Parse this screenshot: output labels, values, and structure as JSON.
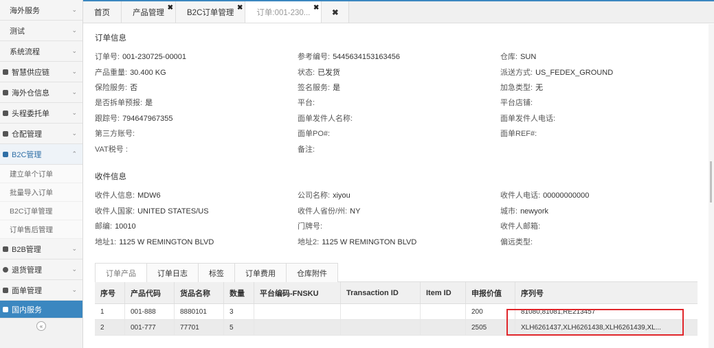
{
  "sidebar": {
    "items": [
      {
        "label": "海外服务"
      },
      {
        "label": "测试"
      },
      {
        "label": "系统流程"
      },
      {
        "label": "智慧供应链"
      },
      {
        "label": "海外仓信息"
      },
      {
        "label": "头程委托单"
      },
      {
        "label": "仓配管理"
      },
      {
        "label": "B2C管理"
      }
    ],
    "b2c_sub": [
      {
        "label": "建立单个订单"
      },
      {
        "label": "批量导入订单"
      },
      {
        "label": "B2C订单管理"
      },
      {
        "label": "订单售后管理"
      }
    ],
    "after": [
      {
        "label": "B2B管理"
      },
      {
        "label": "退货管理"
      },
      {
        "label": "面单管理"
      },
      {
        "label": "国内服务"
      }
    ],
    "collapse_glyph": "«"
  },
  "tabs": [
    {
      "label": "首页"
    },
    {
      "label": "产品管理",
      "close": "✖"
    },
    {
      "label": "B2C订单管理",
      "close": "✖"
    },
    {
      "label": "订单:001-230...",
      "close": "✖"
    },
    {
      "label": "✖"
    }
  ],
  "order_info": {
    "title": "订单信息",
    "fields": [
      {
        "label": "订单号:",
        "value": "001-230725-00001"
      },
      {
        "label": "参考编号:",
        "value": "5445634153163456"
      },
      {
        "label": "仓库:",
        "value": "SUN"
      },
      {
        "label": "产品重量:",
        "value": "30.400 KG"
      },
      {
        "label": "状态:",
        "value": "已发货"
      },
      {
        "label": "派送方式:",
        "value": "US_FEDEX_GROUND"
      },
      {
        "label": "保险服务:",
        "value": "否"
      },
      {
        "label": "签名服务:",
        "value": "是"
      },
      {
        "label": "加急类型:",
        "value": "无"
      },
      {
        "label": "是否拆单预报:",
        "value": "是"
      },
      {
        "label": "平台:",
        "value": ""
      },
      {
        "label": "平台店铺:",
        "value": ""
      },
      {
        "label": "跟踪号:",
        "value": "794647967355"
      },
      {
        "label": "面单发件人名称:",
        "value": ""
      },
      {
        "label": "面单发件人电话:",
        "value": ""
      },
      {
        "label": "第三方账号:",
        "value": ""
      },
      {
        "label": "面单PO#:",
        "value": ""
      },
      {
        "label": "面单REF#:",
        "value": ""
      },
      {
        "label": "VAT税号 :",
        "value": ""
      },
      {
        "label": "备注:",
        "value": ""
      }
    ]
  },
  "receiver_info": {
    "title": "收件信息",
    "fields": [
      {
        "label": "收件人信息:",
        "value": "MDW6"
      },
      {
        "label": "公司名称:",
        "value": "xiyou"
      },
      {
        "label": "收件人电话:",
        "value": "00000000000"
      },
      {
        "label": "收件人国家:",
        "value": "UNITED STATES/US"
      },
      {
        "label": "收件人省份/州:",
        "value": "NY"
      },
      {
        "label": "城市:",
        "value": "newyork"
      },
      {
        "label": "邮编:",
        "value": "10010"
      },
      {
        "label": "门牌号:",
        "value": ""
      },
      {
        "label": "收件人邮箱:",
        "value": ""
      },
      {
        "label": "地址1:",
        "value": "1125 W REMINGTON BLVD"
      },
      {
        "label": "地址2:",
        "value": "1125 W REMINGTON BLVD"
      },
      {
        "label": "偏远类型:",
        "value": ""
      }
    ]
  },
  "bottom_tabs": [
    {
      "label": "订单产品"
    },
    {
      "label": "订单日志"
    },
    {
      "label": "标签"
    },
    {
      "label": "订单费用"
    },
    {
      "label": "仓库附件"
    }
  ],
  "table": {
    "headers": [
      "序号",
      "产品代码",
      "货品名称",
      "数量",
      "平台编码-FNSKU",
      "Transaction ID",
      "Item ID",
      "申报价值",
      "序列号"
    ],
    "rows": [
      [
        "1",
        "001-888",
        "8880101",
        "3",
        "",
        "",
        "",
        "200",
        "81080,81081,RE213457"
      ],
      [
        "2",
        "001-777",
        "77701",
        "5",
        "",
        "",
        "",
        "2505",
        "XLH6261437,XLH6261438,XLH6261439,XL..."
      ]
    ]
  }
}
